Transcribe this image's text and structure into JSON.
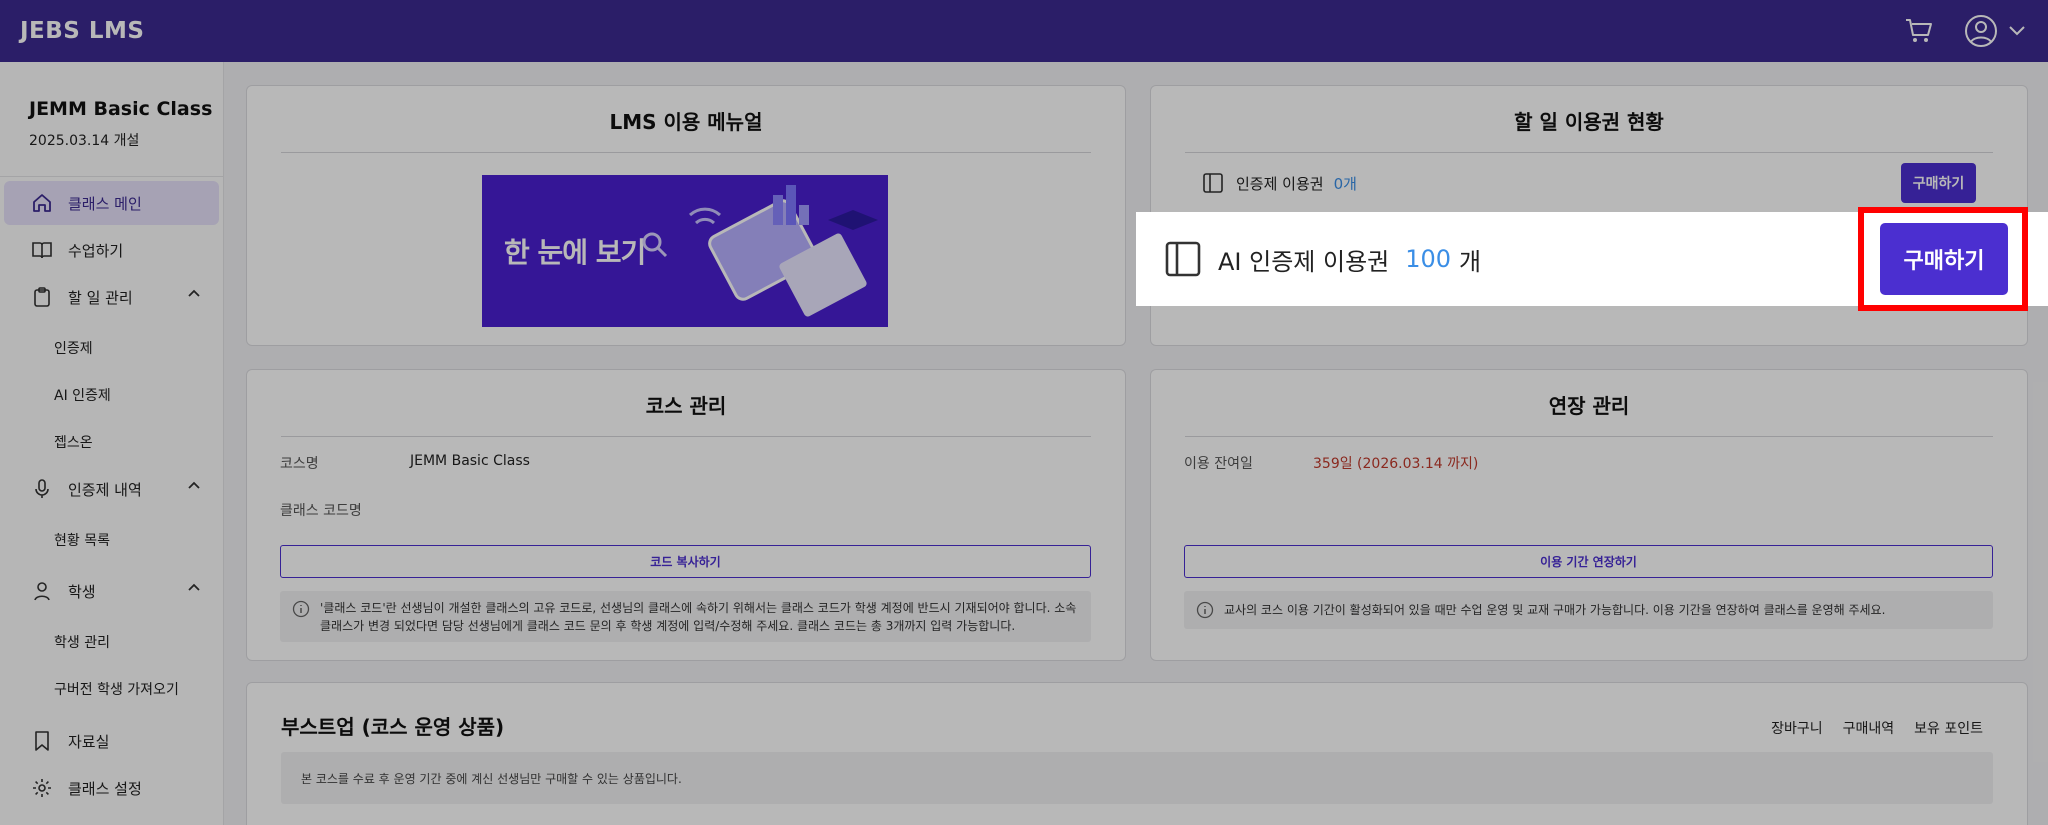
{
  "app": {
    "brand": "JEBS LMS"
  },
  "header": {
    "cart_icon": "cart-icon",
    "user_icon": "user-icon"
  },
  "sidebar": {
    "class_name": "JEMM Basic Class",
    "class_date": "2025.03.14 개설",
    "items": [
      {
        "label": "클래스 메인",
        "icon": "home-icon"
      },
      {
        "label": "수업하기",
        "icon": "book-icon"
      },
      {
        "label": "할 일 관리",
        "icon": "clipboard-icon"
      },
      {
        "label": "인증제"
      },
      {
        "label": "AI 인증제"
      },
      {
        "label": "젭스온"
      },
      {
        "label": "인증제 내역",
        "icon": "mic-icon"
      },
      {
        "label": "현황 목록"
      },
      {
        "label": "학생",
        "icon": "person-icon"
      },
      {
        "label": "학생 관리"
      },
      {
        "label": "구버전 학생 가져오기"
      },
      {
        "label": "자료실",
        "icon": "bookmark-icon"
      },
      {
        "label": "클래스 설정",
        "icon": "gear-icon"
      }
    ]
  },
  "manual": {
    "title": "LMS 이용 메뉴얼",
    "banner_text": "한 눈에 보기"
  },
  "tickets": {
    "title": "할 일 이용권 현황",
    "cert_label": "인증제 이용권",
    "cert_count": "0개",
    "buy_label": "구매하기",
    "ai_label": "AI 인증제 이용권",
    "ai_count": "100",
    "ai_unit": "개",
    "ai_buy_label": "구매하기"
  },
  "course": {
    "title": "코스 관리",
    "name_label": "코스명",
    "name_value": "JEMM Basic Class",
    "code_label": "클래스 코드명",
    "copy_button": "코드 복사하기",
    "notice": "'클래스 코드'란 선생님이 개설한 클래스의 고유 코드로, 선생님의 클래스에 속하기 위해서는 클래스 코드가 학생 계정에 반드시 기재되어야 합니다. 소속 클래스가 변경 되었다면 담당 선생님에게 클래스 코드 문의 후 학생 계정에 입력/수정해 주세요. 클래스 코드는 총 3개까지 입력 가능합니다."
  },
  "extension": {
    "title": "연장 관리",
    "remain_label": "이용 잔여일",
    "remain_value": "359일 (2026.03.14 까지)",
    "extend_button": "이용 기간 연장하기",
    "notice": "교사의 코스 이용 기간이 활성화되어 있을 때만 수업 운영 및 교재 구매가 가능합니다. 이용 기간을 연장하여 클래스를 운영해 주세요."
  },
  "boost": {
    "title": "부스트업 (코스 운영 상품)",
    "links": [
      "장바구니",
      "구매내역",
      "보유 포인트"
    ],
    "notice": "본 코스를 수료 후 운영 기간 중에 계신 선생님만 구매할 수 있는 상품입니다."
  },
  "colors": {
    "header": "#3c2a91",
    "accent": "#4b2fd0",
    "highlight": "#ff0000",
    "count": "#3a8ee6"
  }
}
